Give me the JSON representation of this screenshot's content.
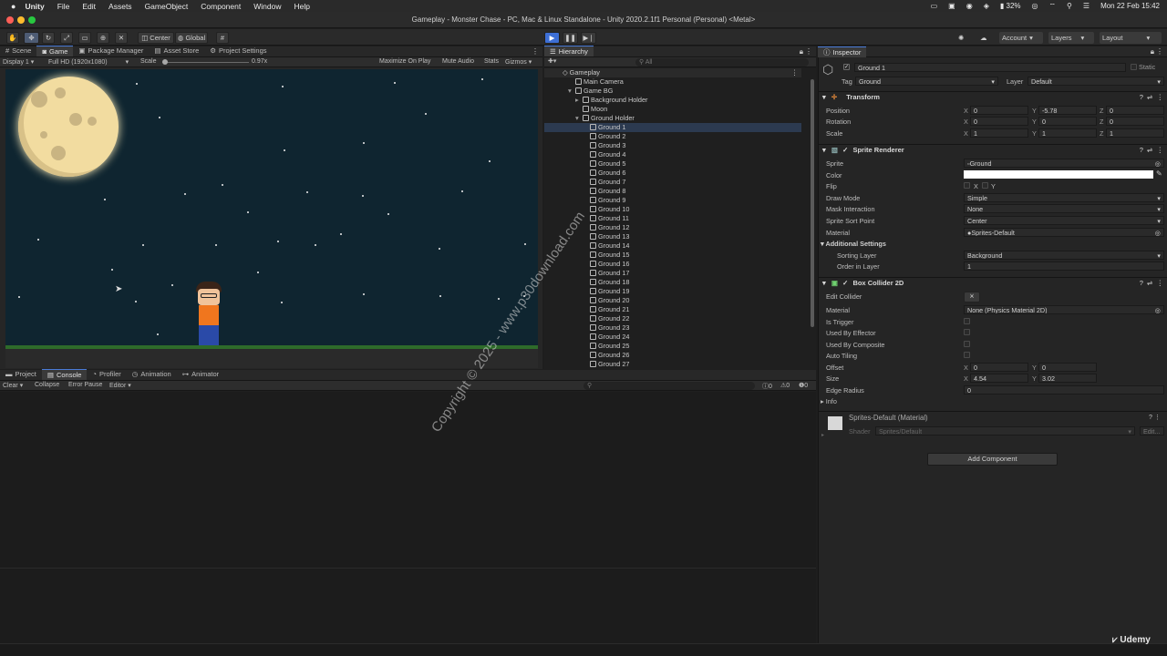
{
  "menubar": {
    "app": "Unity",
    "items": [
      "File",
      "Edit",
      "Assets",
      "GameObject",
      "Component",
      "Window",
      "Help"
    ],
    "battery": "32%",
    "datetime": "Mon 22 Feb  15:42"
  },
  "window": {
    "title": "Gameplay - Monster Chase - PC, Mac & Linux Standalone - Unity 2020.2.1f1 Personal (Personal) <Metal>"
  },
  "toolbar": {
    "center": "Center",
    "global": "Global",
    "account": "Account",
    "layers": "Layers",
    "layout": "Layout"
  },
  "left_tabs": [
    "Scene",
    "Game",
    "Package Manager",
    "Asset Store",
    "Project Settings"
  ],
  "game_bar": {
    "display": "Display 1",
    "resolution": "Full HD (1920x1080)",
    "scale_label": "Scale",
    "scale_value": "0.97x",
    "maximize": "Maximize On Play",
    "mute": "Mute Audio",
    "stats": "Stats",
    "gizmos": "Gizmos"
  },
  "hierarchy": {
    "tab": "Hierarchy",
    "search_placeholder": "All",
    "scene": "Gameplay",
    "items": [
      "Main Camera",
      "Game BG",
      "Background Holder",
      "Moon",
      "Ground Holder",
      "Ground 1",
      "Ground 2",
      "Ground 3",
      "Ground 4",
      "Ground 5",
      "Ground 6",
      "Ground 7",
      "Ground 8",
      "Ground 9",
      "Ground 10",
      "Ground 11",
      "Ground 12",
      "Ground 13",
      "Ground 14",
      "Ground 15",
      "Ground 16",
      "Ground 17",
      "Ground 18",
      "Ground 19",
      "Ground 20",
      "Ground 21",
      "Ground 22",
      "Ground 23",
      "Ground 24",
      "Ground 25",
      "Ground 26",
      "Ground 27"
    ]
  },
  "bottom_tabs": [
    "Project",
    "Console",
    "Profiler",
    "Animation",
    "Animator"
  ],
  "console": {
    "clear": "Clear",
    "collapse": "Collapse",
    "error_pause": "Error Pause",
    "editor": "Editor",
    "count_log": "0",
    "count_warn": "0",
    "count_err": "0"
  },
  "inspector": {
    "tab": "Inspector",
    "object_name": "Ground 1",
    "static": "Static",
    "tag_label": "Tag",
    "tag": "Ground",
    "layer_label": "Layer",
    "layer": "Default",
    "transform": {
      "title": "Transform",
      "position": "Position",
      "rotation": "Rotation",
      "scale": "Scale",
      "px": "0",
      "py": "-5.78",
      "pz": "0",
      "rx": "0",
      "ry": "0",
      "rz": "0",
      "sx": "1",
      "sy": "1",
      "sz": "1"
    },
    "sprite_renderer": {
      "title": "Sprite Renderer",
      "sprite_label": "Sprite",
      "sprite": "Ground",
      "color_label": "Color",
      "flip_label": "Flip",
      "flip_x": "X",
      "flip_y": "Y",
      "draw_mode_label": "Draw Mode",
      "draw_mode": "Simple",
      "mask_label": "Mask Interaction",
      "mask": "None",
      "sort_point_label": "Sprite Sort Point",
      "sort_point": "Center",
      "material_label": "Material",
      "material": "Sprites-Default",
      "additional": "Additional Settings",
      "sorting_layer_label": "Sorting Layer",
      "sorting_layer": "Background",
      "order_label": "Order in Layer",
      "order": "1"
    },
    "box_collider": {
      "title": "Box Collider 2D",
      "edit_collider": "Edit Collider",
      "material_label": "Material",
      "material": "None (Physics Material 2D)",
      "is_trigger": "Is Trigger",
      "used_by_effector": "Used By Effector",
      "used_by_composite": "Used By Composite",
      "auto_tiling": "Auto Tiling",
      "offset_label": "Offset",
      "ox": "0",
      "oy": "0",
      "size_label": "Size",
      "size_x": "4.54",
      "size_y": "3.02",
      "edge_radius_label": "Edge Radius",
      "edge_radius": "0",
      "info": "Info"
    },
    "material_block": {
      "name": "Sprites-Default (Material)",
      "shader_label": "Shader",
      "shader": "Sprites/Default",
      "edit": "Edit..."
    },
    "add_component": "Add Component"
  },
  "watermark": "Copyright © 2025 - www.p30download.com",
  "udemy": "Udemy",
  "colors": {
    "sky": "#0f2530",
    "moon": "#f2dca0",
    "grass": "#2e6b2a",
    "accent": "#4a7bd8"
  }
}
